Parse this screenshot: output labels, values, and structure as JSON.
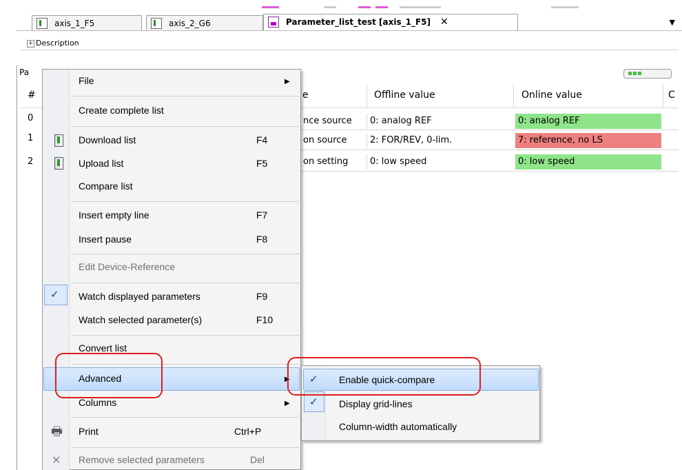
{
  "tabs": [
    {
      "label": "axis_1_F5",
      "icon": "parameter-list-icon",
      "active": false
    },
    {
      "label": "axis_2_G6",
      "icon": "parameter-list-icon",
      "active": false
    },
    {
      "label": "Parameter_list_test [axis_1_F5]",
      "icon": "keb-icon",
      "active": true
    }
  ],
  "tab_close": "✕",
  "description": {
    "expander": "+",
    "label": "Description"
  },
  "grid": {
    "title_partial": "Pa",
    "headers": {
      "num": "#",
      "name_partial": "e",
      "offline": "Offline value",
      "online": "Online value",
      "extra_partial": "C"
    },
    "rows": [
      {
        "num": "0",
        "name": "nce source",
        "offline": "0: analog REF",
        "online": "0: analog REF",
        "status": "match"
      },
      {
        "num": "1",
        "name": "on source",
        "offline": "2: FOR/REV, 0-lim.",
        "online": "7: reference, no LS",
        "status": "mismatch"
      },
      {
        "num": "2",
        "name": "on setting",
        "offline": "0: low speed",
        "online": "0: low speed",
        "status": "match"
      }
    ],
    "colors": {
      "match": "#8fe48a",
      "mismatch": "#ee8080"
    }
  },
  "menu": {
    "file": "File",
    "create_complete": "Create complete list",
    "download": "Download list",
    "download_sc": "F4",
    "upload": "Upload list",
    "upload_sc": "F5",
    "compare": "Compare list",
    "insert_empty": "Insert empty line",
    "insert_empty_sc": "F7",
    "insert_pause": "Insert pause",
    "insert_pause_sc": "F8",
    "edit_device_ref": "Edit Device-Reference",
    "watch_displayed": "Watch displayed parameters",
    "watch_displayed_sc": "F9",
    "watch_selected": "Watch selected parameter(s)",
    "watch_selected_sc": "F10",
    "convert": "Convert list",
    "advanced": "Advanced",
    "columns": "Columns",
    "print": "Print",
    "print_sc": "Ctrl+P",
    "remove": "Remove selected parameters",
    "remove_sc": "Del"
  },
  "submenu": {
    "quick_compare": "Enable quick-compare",
    "grid_lines": "Display grid-lines",
    "col_width": "Column-width automatically"
  },
  "glyphs": {
    "check": "✓",
    "arrow": "▶",
    "dropdown": "▼",
    "printer": "🖶",
    "remove": "✕"
  },
  "accent": {
    "highlight": "#c1dbfc",
    "annotation": "#e01c1c"
  }
}
